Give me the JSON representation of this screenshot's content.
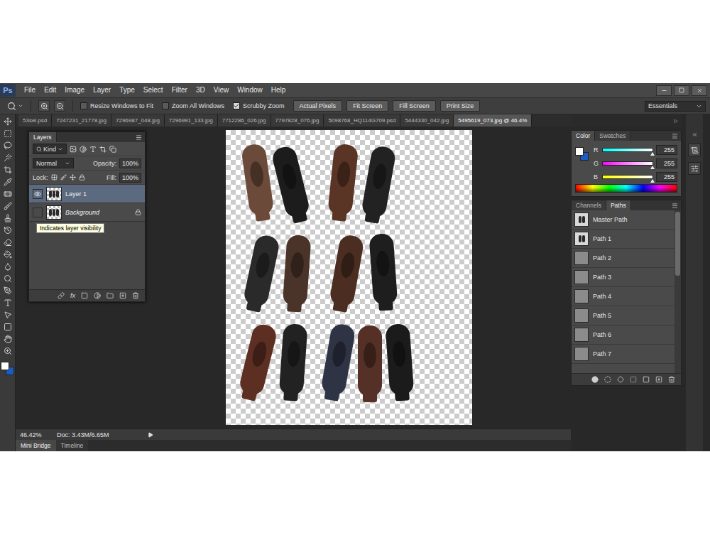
{
  "app": {
    "logo": "Ps"
  },
  "menu": [
    "File",
    "Edit",
    "Image",
    "Layer",
    "Type",
    "Select",
    "Filter",
    "3D",
    "View",
    "Window",
    "Help"
  ],
  "options_bar": {
    "checkboxes": [
      {
        "label": "Resize Windows to Fit",
        "checked": false
      },
      {
        "label": "Zoom All Windows",
        "checked": false
      },
      {
        "label": "Scrubby Zoom",
        "checked": true
      }
    ],
    "buttons": [
      "Actual Pixels",
      "Fit Screen",
      "Fill Screen",
      "Print Size"
    ],
    "workspace": "Essentials"
  },
  "document_tabs": [
    {
      "label": "53sel.psd",
      "selected": false
    },
    {
      "label": "7247231_21778.jpg",
      "selected": false
    },
    {
      "label": "7296987_048.jpg",
      "selected": false
    },
    {
      "label": "7296991_133.jpg",
      "selected": false
    },
    {
      "label": "7712286_026.jpg",
      "selected": false
    },
    {
      "label": "7797828_076.jpg",
      "selected": false
    },
    {
      "label": "5098768_HQ114G709.psd",
      "selected": false
    },
    {
      "label": "5444330_042.jpg",
      "selected": false
    },
    {
      "label": "5495619_073.jpg @ 46.4%",
      "selected": true
    }
  ],
  "layers_panel": {
    "title": "Layers",
    "filter": "Kind",
    "blend_mode": "Normal",
    "opacity_label": "Opacity:",
    "opacity": "100%",
    "lock_label": "Lock:",
    "fill_label": "Fill:",
    "fill": "100%",
    "footer_fx": "fx",
    "layers": [
      {
        "name": "Layer 1",
        "visible": true,
        "selected": true,
        "locked": false
      },
      {
        "name": "Background",
        "visible": false,
        "selected": false,
        "locked": true
      }
    ],
    "tooltip": "Indicates layer visibility"
  },
  "color_panel": {
    "tabs": [
      {
        "label": "Color",
        "selected": true
      },
      {
        "label": "Swatches",
        "selected": false
      }
    ],
    "foreground": "#ffffff",
    "background": "#1a5bc4",
    "channels": [
      {
        "name": "R",
        "value": "255",
        "level": 1
      },
      {
        "name": "G",
        "value": "255",
        "level": 1
      },
      {
        "name": "B",
        "value": "255",
        "level": 1
      }
    ]
  },
  "paths_panel": {
    "tabs": [
      {
        "label": "Channels",
        "selected": false
      },
      {
        "label": "Paths",
        "selected": true
      }
    ],
    "paths": [
      {
        "name": "Master Path",
        "has_artwork": true
      },
      {
        "name": "Path 1",
        "has_artwork": true
      },
      {
        "name": "Path 2",
        "has_artwork": false
      },
      {
        "name": "Path 3",
        "has_artwork": false
      },
      {
        "name": "Path 4",
        "has_artwork": false
      },
      {
        "name": "Path 5",
        "has_artwork": false
      },
      {
        "name": "Path 6",
        "has_artwork": false
      },
      {
        "name": "Path 7",
        "has_artwork": false
      }
    ]
  },
  "status_bar": {
    "zoom": "46.42%",
    "doc": "Doc: 3.43M/6.65M"
  },
  "bottom_tabs": [
    {
      "label": "Mini Bridge",
      "selected": true
    },
    {
      "label": "Timeline",
      "selected": false
    }
  ]
}
